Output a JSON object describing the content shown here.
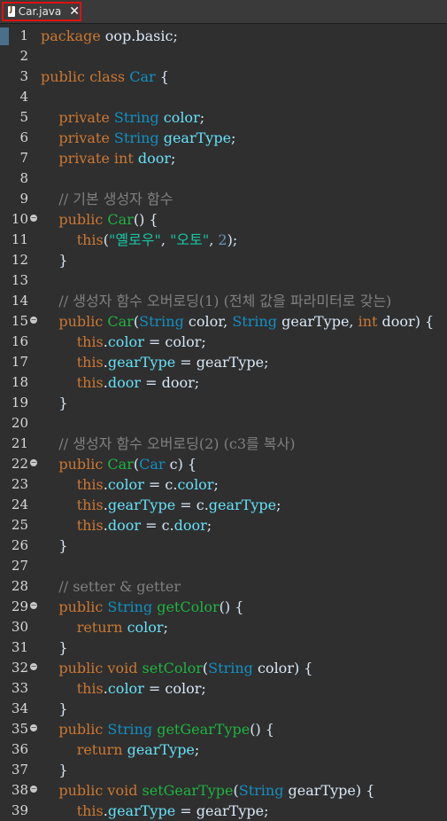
{
  "tab": {
    "label": "Car.java",
    "close": "✕",
    "icon": "java-file-icon"
  },
  "lines": [
    {
      "n": "1",
      "fold": false,
      "t": [
        [
          "kw",
          "package "
        ],
        [
          "plain",
          "oop.basic;"
        ]
      ]
    },
    {
      "n": "2",
      "fold": false,
      "t": []
    },
    {
      "n": "3",
      "fold": false,
      "t": [
        [
          "kw",
          "public class "
        ],
        [
          "cls",
          "Car"
        ],
        [
          "plain",
          " {"
        ]
      ]
    },
    {
      "n": "4",
      "fold": false,
      "t": []
    },
    {
      "n": "5",
      "fold": false,
      "t": [
        [
          "kw",
          "    private "
        ],
        [
          "cls",
          "String "
        ],
        [
          "fld",
          "color"
        ],
        [
          "plain",
          ";"
        ]
      ]
    },
    {
      "n": "6",
      "fold": false,
      "t": [
        [
          "kw",
          "    private "
        ],
        [
          "cls",
          "String "
        ],
        [
          "fld",
          "gearType"
        ],
        [
          "plain",
          ";"
        ]
      ]
    },
    {
      "n": "7",
      "fold": false,
      "t": [
        [
          "kw",
          "    private int "
        ],
        [
          "fld",
          "door"
        ],
        [
          "plain",
          ";"
        ]
      ]
    },
    {
      "n": "8",
      "fold": false,
      "t": []
    },
    {
      "n": "9",
      "fold": false,
      "t": [
        [
          "cm",
          "    // 기본 생성자 함수"
        ]
      ]
    },
    {
      "n": "10",
      "fold": true,
      "t": [
        [
          "kw",
          "    public "
        ],
        [
          "ctor",
          "Car"
        ],
        [
          "plain",
          "() {"
        ]
      ]
    },
    {
      "n": "11",
      "fold": false,
      "t": [
        [
          "kw",
          "        this"
        ],
        [
          "plain",
          "("
        ],
        [
          "str",
          "\"옐로우\""
        ],
        [
          "plain",
          ", "
        ],
        [
          "str",
          "\"오토\""
        ],
        [
          "plain",
          ", "
        ],
        [
          "num",
          "2"
        ],
        [
          "plain",
          ");"
        ]
      ]
    },
    {
      "n": "12",
      "fold": false,
      "t": [
        [
          "plain",
          "    }"
        ]
      ]
    },
    {
      "n": "13",
      "fold": false,
      "t": []
    },
    {
      "n": "14",
      "fold": false,
      "t": [
        [
          "cm",
          "    // 생성자 함수 오버로딩(1) (전체 값을 파라미터로 갖는)"
        ]
      ]
    },
    {
      "n": "15",
      "fold": true,
      "t": [
        [
          "kw",
          "    public "
        ],
        [
          "ctor",
          "Car"
        ],
        [
          "plain",
          "("
        ],
        [
          "cls",
          "String "
        ],
        [
          "plain",
          "color, "
        ],
        [
          "cls",
          "String "
        ],
        [
          "plain",
          "gearType, "
        ],
        [
          "kw",
          "int "
        ],
        [
          "plain",
          "door) {"
        ]
      ]
    },
    {
      "n": "16",
      "fold": false,
      "t": [
        [
          "kw",
          "        this"
        ],
        [
          "plain",
          "."
        ],
        [
          "fld",
          "color"
        ],
        [
          "plain",
          " = color;"
        ]
      ]
    },
    {
      "n": "17",
      "fold": false,
      "t": [
        [
          "kw",
          "        this"
        ],
        [
          "plain",
          "."
        ],
        [
          "fld",
          "gearType"
        ],
        [
          "plain",
          " = gearType;"
        ]
      ]
    },
    {
      "n": "18",
      "fold": false,
      "t": [
        [
          "kw",
          "        this"
        ],
        [
          "plain",
          "."
        ],
        [
          "fld",
          "door"
        ],
        [
          "plain",
          " = door;"
        ]
      ]
    },
    {
      "n": "19",
      "fold": false,
      "t": [
        [
          "plain",
          "    }"
        ]
      ]
    },
    {
      "n": "20",
      "fold": false,
      "t": []
    },
    {
      "n": "21",
      "fold": false,
      "t": [
        [
          "cm",
          "    // 생성자 함수 오버로딩(2) (c3를 복사)"
        ]
      ]
    },
    {
      "n": "22",
      "fold": true,
      "t": [
        [
          "kw",
          "    public "
        ],
        [
          "ctor",
          "Car"
        ],
        [
          "plain",
          "("
        ],
        [
          "cls",
          "Car "
        ],
        [
          "plain",
          "c) {"
        ]
      ]
    },
    {
      "n": "23",
      "fold": false,
      "t": [
        [
          "kw",
          "        this"
        ],
        [
          "plain",
          "."
        ],
        [
          "fld",
          "color"
        ],
        [
          "plain",
          " = c."
        ],
        [
          "fld",
          "color"
        ],
        [
          "plain",
          ";"
        ]
      ]
    },
    {
      "n": "24",
      "fold": false,
      "t": [
        [
          "kw",
          "        this"
        ],
        [
          "plain",
          "."
        ],
        [
          "fld",
          "gearType"
        ],
        [
          "plain",
          " = c."
        ],
        [
          "fld",
          "gearType"
        ],
        [
          "plain",
          ";"
        ]
      ]
    },
    {
      "n": "25",
      "fold": false,
      "t": [
        [
          "kw",
          "        this"
        ],
        [
          "plain",
          "."
        ],
        [
          "fld",
          "door"
        ],
        [
          "plain",
          " = c."
        ],
        [
          "fld",
          "door"
        ],
        [
          "plain",
          ";"
        ]
      ]
    },
    {
      "n": "26",
      "fold": false,
      "t": [
        [
          "plain",
          "    }"
        ]
      ]
    },
    {
      "n": "27",
      "fold": false,
      "t": []
    },
    {
      "n": "28",
      "fold": false,
      "t": [
        [
          "cm",
          "    // setter & getter"
        ]
      ]
    },
    {
      "n": "29",
      "fold": true,
      "t": [
        [
          "kw",
          "    public "
        ],
        [
          "cls",
          "String "
        ],
        [
          "ctor",
          "getColor"
        ],
        [
          "plain",
          "() {"
        ]
      ]
    },
    {
      "n": "30",
      "fold": false,
      "t": [
        [
          "kw",
          "        return "
        ],
        [
          "fld",
          "color"
        ],
        [
          "plain",
          ";"
        ]
      ]
    },
    {
      "n": "31",
      "fold": false,
      "t": [
        [
          "plain",
          "    }"
        ]
      ]
    },
    {
      "n": "32",
      "fold": true,
      "t": [
        [
          "kw",
          "    public void "
        ],
        [
          "ctor",
          "setColor"
        ],
        [
          "plain",
          "("
        ],
        [
          "cls",
          "String "
        ],
        [
          "plain",
          "color) {"
        ]
      ]
    },
    {
      "n": "33",
      "fold": false,
      "t": [
        [
          "kw",
          "        this"
        ],
        [
          "plain",
          "."
        ],
        [
          "fld",
          "color"
        ],
        [
          "plain",
          " = color;"
        ]
      ]
    },
    {
      "n": "34",
      "fold": false,
      "t": [
        [
          "plain",
          "    }"
        ]
      ]
    },
    {
      "n": "35",
      "fold": true,
      "t": [
        [
          "kw",
          "    public "
        ],
        [
          "cls",
          "String "
        ],
        [
          "ctor",
          "getGearType"
        ],
        [
          "plain",
          "() {"
        ]
      ]
    },
    {
      "n": "36",
      "fold": false,
      "t": [
        [
          "kw",
          "        return "
        ],
        [
          "fld",
          "gearType"
        ],
        [
          "plain",
          ";"
        ]
      ]
    },
    {
      "n": "37",
      "fold": false,
      "t": [
        [
          "plain",
          "    }"
        ]
      ]
    },
    {
      "n": "38",
      "fold": true,
      "t": [
        [
          "kw",
          "    public void "
        ],
        [
          "ctor",
          "setGearType"
        ],
        [
          "plain",
          "("
        ],
        [
          "cls",
          "String "
        ],
        [
          "plain",
          "gearType) {"
        ]
      ]
    },
    {
      "n": "39",
      "fold": false,
      "t": [
        [
          "kw",
          "        this"
        ],
        [
          "plain",
          "."
        ],
        [
          "fld",
          "gearType"
        ],
        [
          "plain",
          " = gearType;"
        ]
      ]
    }
  ]
}
